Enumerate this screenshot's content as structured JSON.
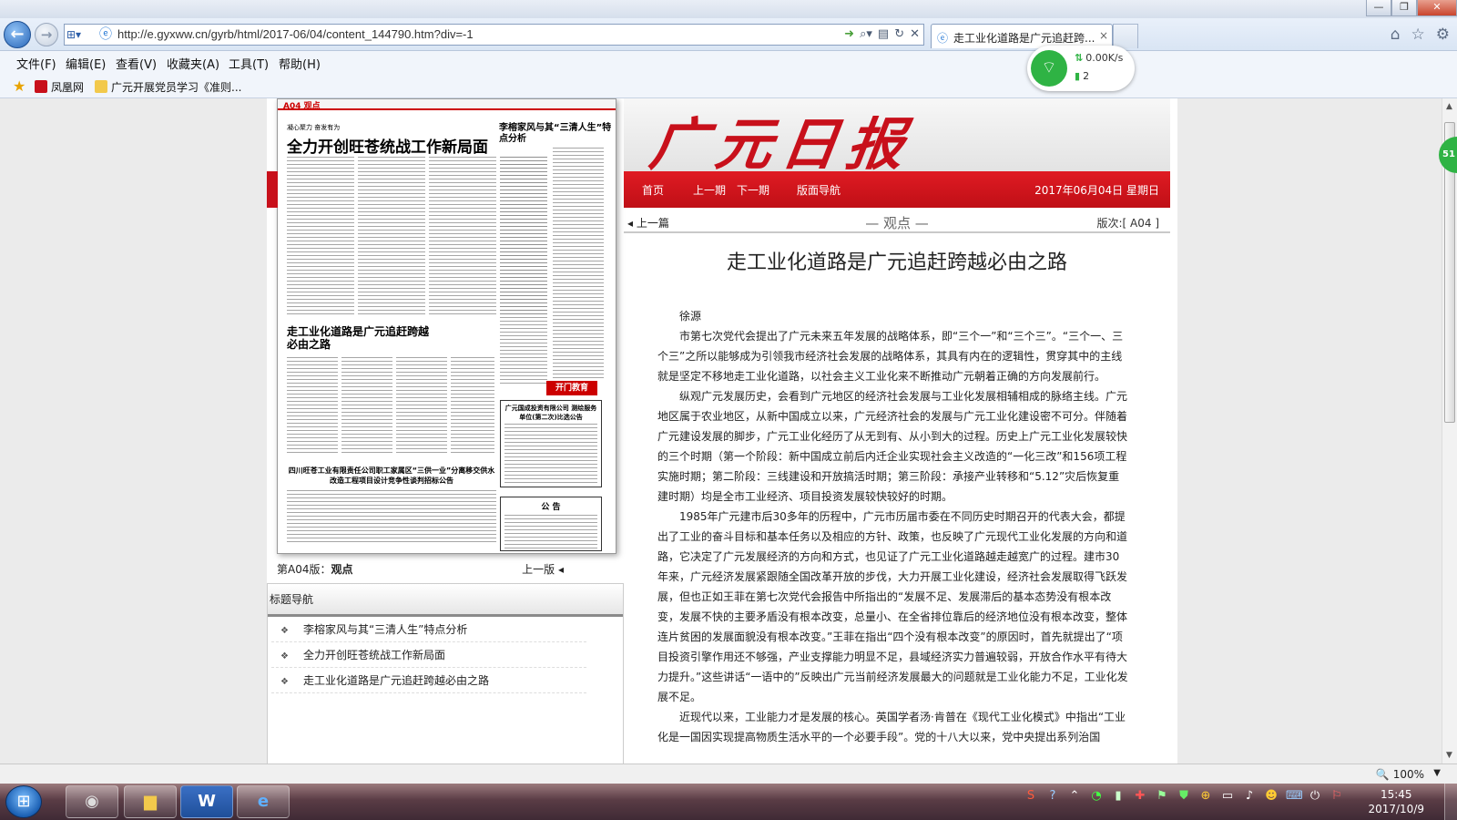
{
  "browser": {
    "url": "http://e.gyxww.cn/gyrb/html/2017-06/04/content_144790.htm?div=-1",
    "tab_title": "走工业化道路是广元追赶跨...",
    "tab_close": "×",
    "menu": [
      "文件(F)",
      "编辑(E)",
      "查看(V)",
      "收藏夹(A)",
      "工具(T)",
      "帮助(H)"
    ],
    "favorites": [
      "凤凰网",
      "广元开展党员学习《准则..."
    ],
    "net_speed": "0.00K/s",
    "net_count": "2",
    "zoom": "100%",
    "side_badge": "51"
  },
  "paper": {
    "thumb": {
      "band_label": "A04 观点",
      "sub_headline": "凝心聚力 奋发有为",
      "headline": "全力开创旺苍统战工作新局面",
      "headline2": "李榕家风与其“三清人生”特点分析",
      "headline3": "走工业化道路是广元追赶跨越必由之路",
      "notice_title": "四川旺苍工业有限责任公司职工家属区“三供一业”分离移交供水改造工程项目设计竞争性谈判招标公告",
      "ad": "开门教育",
      "box1_title": "广元国成投资有限公司 测绘服务单位(第二次)比选公告",
      "box2_title": "公 告"
    },
    "current_page_label": "第A04版：",
    "current_page_name": "观点",
    "prev_page": "上一版",
    "title_nav_heading": "标题导航",
    "title_nav_items": [
      "李榕家风与其“三清人生”特点分析",
      "全力开创旺苍统战工作新局面",
      "走工业化道路是广元追赶跨越必由之路"
    ],
    "masthead_logo": "广元日报",
    "nav": {
      "home": "首页",
      "prev_issue": "上一期",
      "next_issue": "下一期",
      "layout": "版面导航",
      "date": "2017年06月04日  星期日"
    },
    "article": {
      "prev_article": "上一篇",
      "section": "— 观点 —",
      "page_no": "版次:[ A04 ]",
      "title": "走工业化道路是广元追赶跨越必由之路",
      "author": "徐源",
      "paragraphs": [
        "市第七次党代会提出了广元未来五年发展的战略体系，即“三个一”和“三个三”。“三个一、三个三”之所以能够成为引领我市经济社会发展的战略体系，其具有内在的逻辑性，贯穿其中的主线就是坚定不移地走工业化道路，以社会主义工业化来不断推动广元朝着正确的方向发展前行。",
        "纵观广元发展历史，会看到广元地区的经济社会发展与工业化发展相辅相成的脉络主线。广元地区属于农业地区，从新中国成立以来，广元经济社会的发展与广元工业化建设密不可分。伴随着广元建设发展的脚步，广元工业化经历了从无到有、从小到大的过程。历史上广元工业化发展较快的三个时期（第一个阶段：新中国成立前后内迁企业实现社会主义改造的“一化三改”和156项工程实施时期；第二阶段：三线建设和开放搞活时期；第三阶段：承接产业转移和“5.12”灾后恢复重建时期）均是全市工业经济、项目投资发展较快较好的时期。",
        "1985年广元建市后30多年的历程中，广元市历届市委在不同历史时期召开的代表大会，都提出了工业的奋斗目标和基本任务以及相应的方针、政策，也反映了广元现代工业化发展的方向和道路，它决定了广元发展经济的方向和方式，也见证了广元工业化道路越走越宽广的过程。建市30年来，广元经济发展紧跟随全国改革开放的步伐，大力开展工业化建设，经济社会发展取得飞跃发展，但也正如王菲在第七次党代会报告中所指出的“发展不足、发展滞后的基本态势没有根本改变，发展不快的主要矛盾没有根本改变，总量小、在全省排位靠后的经济地位没有根本改变，整体连片贫困的发展面貌没有根本改变。”王菲在指出“四个没有根本改变”的原因时，首先就提出了“项目投资引擎作用还不够强，产业支撑能力明显不足，县域经济实力普遍较弱，开放合作水平有待大力提升。”这些讲话“一语中的”反映出广元当前经济发展最大的问题就是工业化能力不足，工业化发展不足。",
        "近现代以来，工业能力才是发展的核心。英国学者汤·肯普在《现代工业化模式》中指出“工业化是一国因实现提高物质生活水平的一个必要手段”。党的十八大以来，党中央提出系列治国"
      ]
    }
  },
  "taskbar": {
    "clock_time": "15:45",
    "clock_date": "2017/10/9"
  },
  "colors": {
    "paper_red": "#d0121b",
    "ie_blue": "#2866b8",
    "taskbar": "#5a3c45",
    "wifi_green": "#2fb344"
  },
  "icons": [
    "back-arrow-icon",
    "forward-arrow-icon",
    "compat-view-icon",
    "page-icon",
    "go-icon",
    "search-icon",
    "stop-icon",
    "refresh-icon",
    "home-icon",
    "star-icon",
    "gear-icon",
    "wifi-icon",
    "windows-logo-icon",
    "folder-icon",
    "word-icon",
    "ie-icon"
  ]
}
